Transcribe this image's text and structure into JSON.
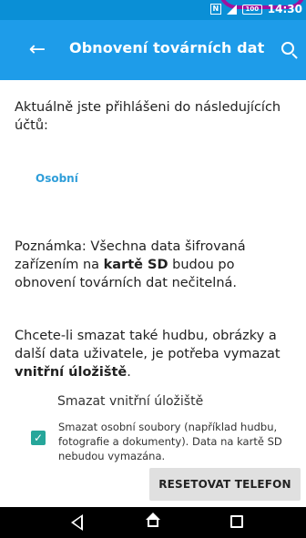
{
  "status_bar": {
    "time": "14:30",
    "battery": "100",
    "nfc": "N"
  },
  "toolbar": {
    "title": "Obnovení továrních dat"
  },
  "content": {
    "intro": "Aktuálně jste přihlášeni do následujících účtů:",
    "account": "Osobní",
    "note_prefix": "Poznámka: Všechna data šifrovaná zařízením na ",
    "note_bold": "kartě SD",
    "note_suffix": " budou po obnovení továrních dat nečitelná.",
    "erase_prefix": "Chcete-li smazat také hudbu, obrázky a další data uživatele, je potřeba vymazat ",
    "erase_bold": "vnitřní úložiště",
    "erase_suffix": ".",
    "section_label": "Smazat vnitřní úložiště",
    "checkbox_desc": "Smazat osobní soubory (například hudbu, fotografie a dokumenty). Data na kartě SD nebudou vymazána.",
    "checkbox_checked": true
  },
  "actions": {
    "reset_label": "RESETOVAT TELEFON"
  },
  "colors": {
    "status_bar": "#0a8fd6",
    "toolbar": "#1e9ce9",
    "accent": "#26a69a",
    "link": "#2f9ed9"
  }
}
